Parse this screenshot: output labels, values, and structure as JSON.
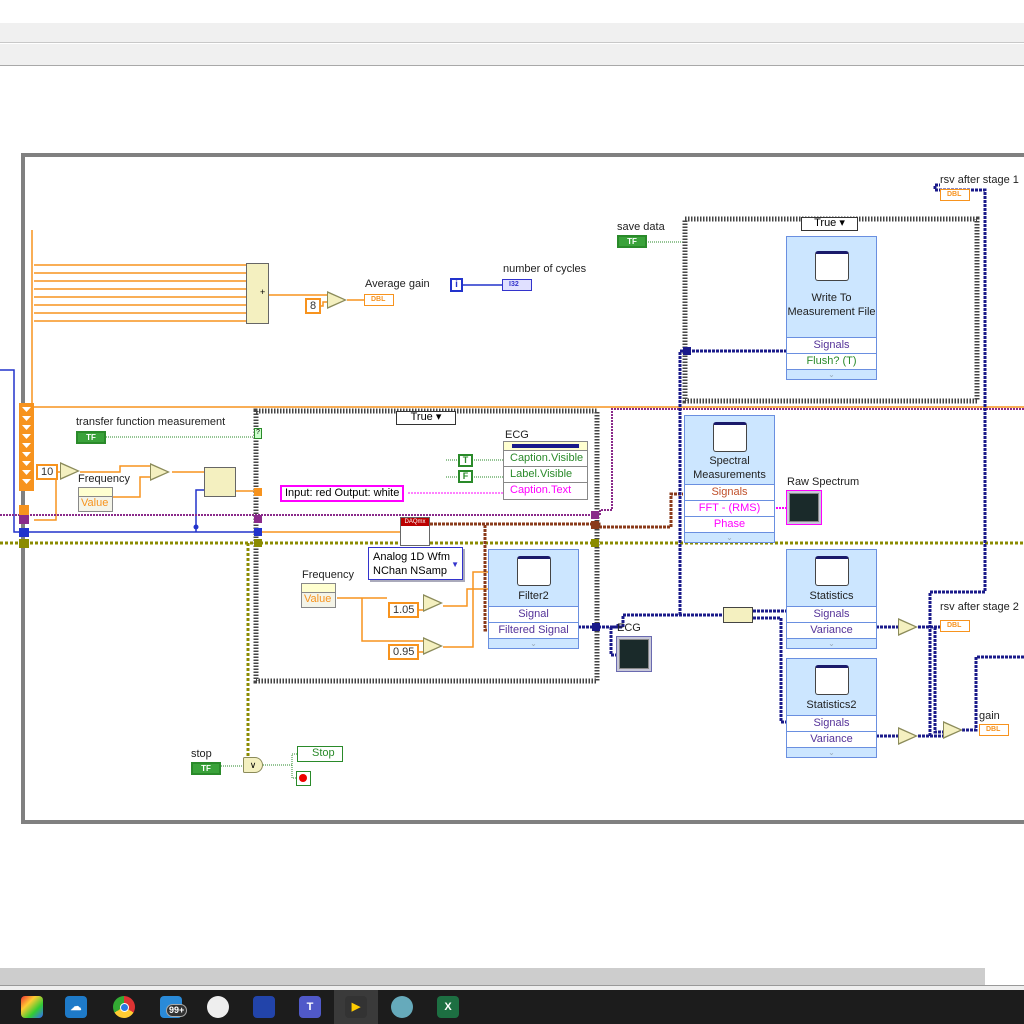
{
  "diagram": {
    "labels": {
      "average_gain": "Average gain",
      "number_of_cycles": "number of cycles",
      "transfer_function": "transfer function measurement",
      "frequency1": "Frequency",
      "frequency2": "Frequency",
      "ecg_prop": "ECG",
      "ecg_graph": "ECG",
      "save_data": "save data",
      "rsv1": "rsv after stage 1",
      "rsv2": "rsv after stage 2",
      "raw_spectrum": "Raw Spectrum",
      "gain": "gain",
      "stop": "stop"
    },
    "constants": {
      "eight": "8",
      "ten": "10",
      "c105": "1.05",
      "c095": "0.95",
      "true_bool": "T",
      "false_bool": "F",
      "string": "Input: red Output: white",
      "iter": "i"
    },
    "indicators": {
      "dbl": "DBL",
      "i32": "I32",
      "tf": "TF"
    },
    "case_inner": {
      "selector": "True"
    },
    "case_write": {
      "selector": "True"
    },
    "property_freq": {
      "value": "Value"
    },
    "ecg_property": {
      "rows": [
        "Caption.Visible",
        "Label.Visible",
        "Caption.Text"
      ]
    },
    "daqmx": {
      "badge": "DAQmx",
      "mode_line1": "Analog 1D Wfm",
      "mode_line2": "NChan NSamp"
    },
    "filter2": {
      "title": "Filter2",
      "rows": [
        "Signal",
        "Filtered Signal"
      ]
    },
    "write_file": {
      "title": "Write To Measurement File",
      "rows": [
        "Signals",
        "Flush? (T)"
      ]
    },
    "spectral": {
      "title": "Spectral Measurements",
      "rows": [
        "Signals",
        "FFT - (RMS)",
        "Phase"
      ]
    },
    "statistics": {
      "title": "Statistics",
      "rows": [
        "Signals",
        "Variance"
      ]
    },
    "statistics2": {
      "title": "Statistics2",
      "rows": [
        "Signals",
        "Variance"
      ]
    },
    "stop_prop": {
      "label": "Stop"
    }
  },
  "taskbar": {
    "icons": [
      "app-launcher",
      "onedrive",
      "chrome",
      "mail",
      "snipping-tool",
      "network",
      "teams",
      "labview",
      "paint",
      "excel"
    ],
    "mail_badge": "99+"
  },
  "colors": {
    "orange": "#f7931e",
    "blue_wire": "#1a1a8a",
    "olive": "#8b8b00",
    "purple": "#8a2a8a",
    "pink": "#ff00ff",
    "green": "#2a8a2a"
  }
}
